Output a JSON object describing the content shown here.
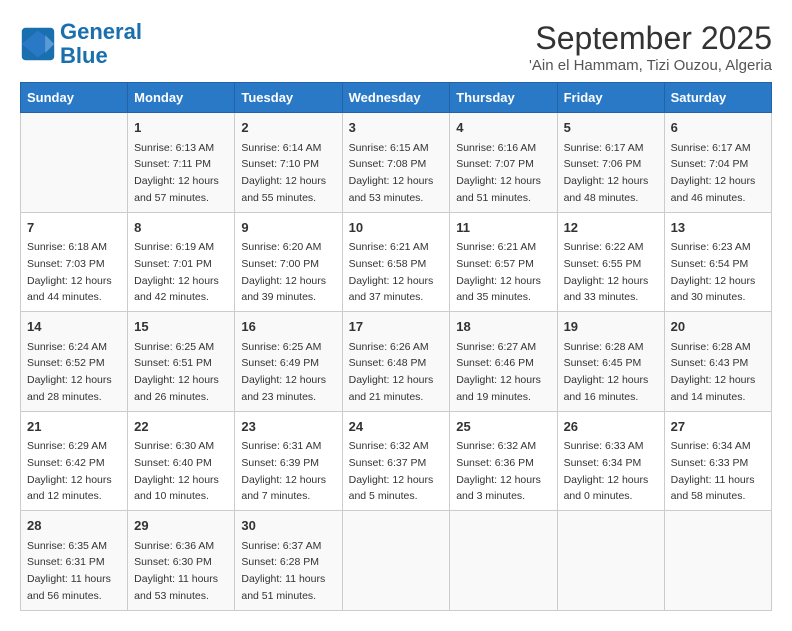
{
  "header": {
    "logo_line1": "General",
    "logo_line2": "Blue",
    "month": "September 2025",
    "location": "'Ain el Hammam, Tizi Ouzou, Algeria"
  },
  "days_of_week": [
    "Sunday",
    "Monday",
    "Tuesday",
    "Wednesday",
    "Thursday",
    "Friday",
    "Saturday"
  ],
  "weeks": [
    [
      {
        "day": "",
        "info": ""
      },
      {
        "day": "1",
        "info": "Sunrise: 6:13 AM\nSunset: 7:11 PM\nDaylight: 12 hours\nand 57 minutes."
      },
      {
        "day": "2",
        "info": "Sunrise: 6:14 AM\nSunset: 7:10 PM\nDaylight: 12 hours\nand 55 minutes."
      },
      {
        "day": "3",
        "info": "Sunrise: 6:15 AM\nSunset: 7:08 PM\nDaylight: 12 hours\nand 53 minutes."
      },
      {
        "day": "4",
        "info": "Sunrise: 6:16 AM\nSunset: 7:07 PM\nDaylight: 12 hours\nand 51 minutes."
      },
      {
        "day": "5",
        "info": "Sunrise: 6:17 AM\nSunset: 7:06 PM\nDaylight: 12 hours\nand 48 minutes."
      },
      {
        "day": "6",
        "info": "Sunrise: 6:17 AM\nSunset: 7:04 PM\nDaylight: 12 hours\nand 46 minutes."
      }
    ],
    [
      {
        "day": "7",
        "info": "Sunrise: 6:18 AM\nSunset: 7:03 PM\nDaylight: 12 hours\nand 44 minutes."
      },
      {
        "day": "8",
        "info": "Sunrise: 6:19 AM\nSunset: 7:01 PM\nDaylight: 12 hours\nand 42 minutes."
      },
      {
        "day": "9",
        "info": "Sunrise: 6:20 AM\nSunset: 7:00 PM\nDaylight: 12 hours\nand 39 minutes."
      },
      {
        "day": "10",
        "info": "Sunrise: 6:21 AM\nSunset: 6:58 PM\nDaylight: 12 hours\nand 37 minutes."
      },
      {
        "day": "11",
        "info": "Sunrise: 6:21 AM\nSunset: 6:57 PM\nDaylight: 12 hours\nand 35 minutes."
      },
      {
        "day": "12",
        "info": "Sunrise: 6:22 AM\nSunset: 6:55 PM\nDaylight: 12 hours\nand 33 minutes."
      },
      {
        "day": "13",
        "info": "Sunrise: 6:23 AM\nSunset: 6:54 PM\nDaylight: 12 hours\nand 30 minutes."
      }
    ],
    [
      {
        "day": "14",
        "info": "Sunrise: 6:24 AM\nSunset: 6:52 PM\nDaylight: 12 hours\nand 28 minutes."
      },
      {
        "day": "15",
        "info": "Sunrise: 6:25 AM\nSunset: 6:51 PM\nDaylight: 12 hours\nand 26 minutes."
      },
      {
        "day": "16",
        "info": "Sunrise: 6:25 AM\nSunset: 6:49 PM\nDaylight: 12 hours\nand 23 minutes."
      },
      {
        "day": "17",
        "info": "Sunrise: 6:26 AM\nSunset: 6:48 PM\nDaylight: 12 hours\nand 21 minutes."
      },
      {
        "day": "18",
        "info": "Sunrise: 6:27 AM\nSunset: 6:46 PM\nDaylight: 12 hours\nand 19 minutes."
      },
      {
        "day": "19",
        "info": "Sunrise: 6:28 AM\nSunset: 6:45 PM\nDaylight: 12 hours\nand 16 minutes."
      },
      {
        "day": "20",
        "info": "Sunrise: 6:28 AM\nSunset: 6:43 PM\nDaylight: 12 hours\nand 14 minutes."
      }
    ],
    [
      {
        "day": "21",
        "info": "Sunrise: 6:29 AM\nSunset: 6:42 PM\nDaylight: 12 hours\nand 12 minutes."
      },
      {
        "day": "22",
        "info": "Sunrise: 6:30 AM\nSunset: 6:40 PM\nDaylight: 12 hours\nand 10 minutes."
      },
      {
        "day": "23",
        "info": "Sunrise: 6:31 AM\nSunset: 6:39 PM\nDaylight: 12 hours\nand 7 minutes."
      },
      {
        "day": "24",
        "info": "Sunrise: 6:32 AM\nSunset: 6:37 PM\nDaylight: 12 hours\nand 5 minutes."
      },
      {
        "day": "25",
        "info": "Sunrise: 6:32 AM\nSunset: 6:36 PM\nDaylight: 12 hours\nand 3 minutes."
      },
      {
        "day": "26",
        "info": "Sunrise: 6:33 AM\nSunset: 6:34 PM\nDaylight: 12 hours\nand 0 minutes."
      },
      {
        "day": "27",
        "info": "Sunrise: 6:34 AM\nSunset: 6:33 PM\nDaylight: 11 hours\nand 58 minutes."
      }
    ],
    [
      {
        "day": "28",
        "info": "Sunrise: 6:35 AM\nSunset: 6:31 PM\nDaylight: 11 hours\nand 56 minutes."
      },
      {
        "day": "29",
        "info": "Sunrise: 6:36 AM\nSunset: 6:30 PM\nDaylight: 11 hours\nand 53 minutes."
      },
      {
        "day": "30",
        "info": "Sunrise: 6:37 AM\nSunset: 6:28 PM\nDaylight: 11 hours\nand 51 minutes."
      },
      {
        "day": "",
        "info": ""
      },
      {
        "day": "",
        "info": ""
      },
      {
        "day": "",
        "info": ""
      },
      {
        "day": "",
        "info": ""
      }
    ]
  ]
}
